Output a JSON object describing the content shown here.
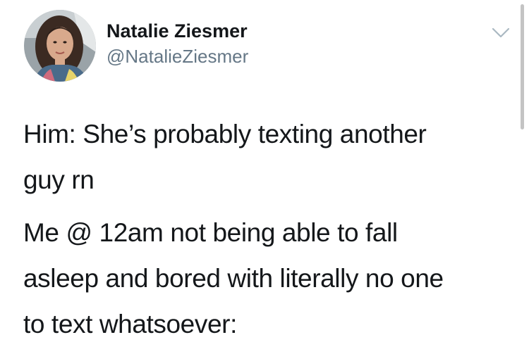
{
  "tweet": {
    "author": {
      "display_name": "Natalie Ziesmer",
      "handle": "@NatalieZiesmer",
      "avatar_icon": "profile-photo"
    },
    "menu_icon": "chevron-down-icon",
    "text_paragraphs": [
      "Him: She’s probably texting another\nguy rn",
      "Me @ 12am not being able to fall\nasleep and bored with literally no one\nto text whatsoever:"
    ]
  },
  "colors": {
    "text_primary": "#14171a",
    "text_secondary": "#657786",
    "chevron": "#aab8c2",
    "background": "#ffffff",
    "scrollbar": "#c4c4c4"
  }
}
